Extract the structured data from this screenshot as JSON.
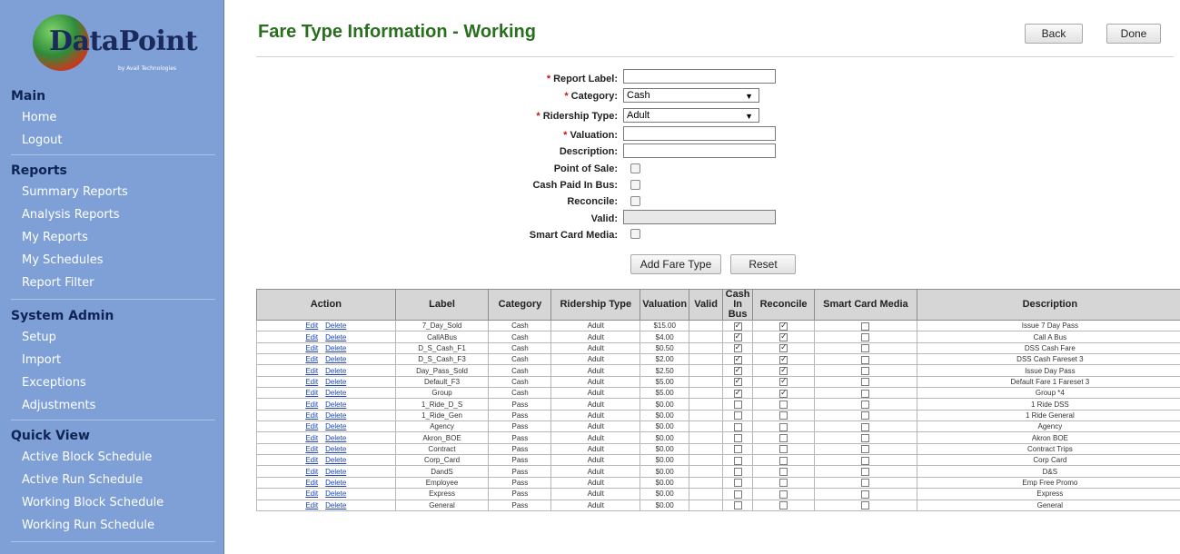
{
  "logo": {
    "text": "DataPoint",
    "subtext": "by Avail Technologies"
  },
  "nav": [
    {
      "title": "Main",
      "items": [
        "Home",
        "Logout"
      ]
    },
    {
      "title": "Reports",
      "items": [
        "Summary Reports",
        "Analysis Reports",
        "My Reports",
        "My Schedules",
        "Report Filter"
      ]
    },
    {
      "title": "System Admin",
      "items": [
        "Setup",
        "Import",
        "Exceptions",
        "Adjustments"
      ]
    },
    {
      "title": "Quick View",
      "items": [
        "Active Block Schedule",
        "Active Run Schedule",
        "Working Block Schedule",
        "Working Run Schedule"
      ]
    }
  ],
  "page": {
    "title": "Fare Type Information - Working"
  },
  "toolbar": {
    "back": "Back",
    "done": "Done"
  },
  "form": {
    "report_label": {
      "label": "Report Label:",
      "value": ""
    },
    "category": {
      "label": "Category:",
      "value": "Cash"
    },
    "ridership_type": {
      "label": "Ridership Type:",
      "value": "Adult"
    },
    "valuation": {
      "label": "Valuation:",
      "value": ""
    },
    "description": {
      "label": "Description:",
      "value": ""
    },
    "point_of_sale": {
      "label": "Point of Sale:"
    },
    "cash_paid_in_bus": {
      "label": "Cash Paid In Bus:"
    },
    "reconcile": {
      "label": "Reconcile:"
    },
    "valid": {
      "label": "Valid:",
      "value": ""
    },
    "smart_card_media": {
      "label": "Smart Card Media:"
    },
    "required_mark": "*",
    "add_button": "Add Fare Type",
    "reset_button": "Reset"
  },
  "table": {
    "headers": [
      "Action",
      "Label",
      "Category",
      "Ridership Type",
      "Valuation",
      "Valid",
      "Cash In Bus",
      "Reconcile",
      "Smart Card Media",
      "Description"
    ],
    "edit_label": "Edit",
    "delete_label": "Delete",
    "rows": [
      {
        "label": "7_Day_Sold",
        "category": "Cash",
        "ridership": "Adult",
        "valuation": "$15.00",
        "cash_in_bus": true,
        "reconcile": true,
        "smart_card": false,
        "description": "Issue 7 Day Pass"
      },
      {
        "label": "CallABus",
        "category": "Cash",
        "ridership": "Adult",
        "valuation": "$4.00",
        "cash_in_bus": true,
        "reconcile": true,
        "smart_card": false,
        "description": "Call A Bus"
      },
      {
        "label": "D_S_Cash_F1",
        "category": "Cash",
        "ridership": "Adult",
        "valuation": "$0.50",
        "cash_in_bus": true,
        "reconcile": true,
        "smart_card": false,
        "description": "DSS Cash Fare"
      },
      {
        "label": "D_S_Cash_F3",
        "category": "Cash",
        "ridership": "Adult",
        "valuation": "$2.00",
        "cash_in_bus": true,
        "reconcile": true,
        "smart_card": false,
        "description": "DSS Cash Fareset 3"
      },
      {
        "label": "Day_Pass_Sold",
        "category": "Cash",
        "ridership": "Adult",
        "valuation": "$2.50",
        "cash_in_bus": true,
        "reconcile": true,
        "smart_card": false,
        "description": "Issue Day Pass"
      },
      {
        "label": "Default_F3",
        "category": "Cash",
        "ridership": "Adult",
        "valuation": "$5.00",
        "cash_in_bus": true,
        "reconcile": true,
        "smart_card": false,
        "description": "Default Fare 1 Fareset 3"
      },
      {
        "label": "Group",
        "category": "Cash",
        "ridership": "Adult",
        "valuation": "$5.00",
        "cash_in_bus": true,
        "reconcile": true,
        "smart_card": false,
        "description": "Group *4"
      },
      {
        "label": "1_Ride_D_S",
        "category": "Pass",
        "ridership": "Adult",
        "valuation": "$0.00",
        "cash_in_bus": false,
        "reconcile": false,
        "smart_card": false,
        "description": "1 Ride DSS"
      },
      {
        "label": "1_Ride_Gen",
        "category": "Pass",
        "ridership": "Adult",
        "valuation": "$0.00",
        "cash_in_bus": false,
        "reconcile": false,
        "smart_card": false,
        "description": "1 Ride General"
      },
      {
        "label": "Agency",
        "category": "Pass",
        "ridership": "Adult",
        "valuation": "$0.00",
        "cash_in_bus": false,
        "reconcile": false,
        "smart_card": false,
        "description": "Agency"
      },
      {
        "label": "Akron_BOE",
        "category": "Pass",
        "ridership": "Adult",
        "valuation": "$0.00",
        "cash_in_bus": false,
        "reconcile": false,
        "smart_card": false,
        "description": "Akron BOE"
      },
      {
        "label": "Contract",
        "category": "Pass",
        "ridership": "Adult",
        "valuation": "$0.00",
        "cash_in_bus": false,
        "reconcile": false,
        "smart_card": false,
        "description": "Contract Trips"
      },
      {
        "label": "Corp_Card",
        "category": "Pass",
        "ridership": "Adult",
        "valuation": "$0.00",
        "cash_in_bus": false,
        "reconcile": false,
        "smart_card": false,
        "description": "Corp Card"
      },
      {
        "label": "DandS",
        "category": "Pass",
        "ridership": "Adult",
        "valuation": "$0.00",
        "cash_in_bus": false,
        "reconcile": false,
        "smart_card": false,
        "description": "D&S"
      },
      {
        "label": "Employee",
        "category": "Pass",
        "ridership": "Adult",
        "valuation": "$0.00",
        "cash_in_bus": false,
        "reconcile": false,
        "smart_card": false,
        "description": "Emp Free Promo"
      },
      {
        "label": "Express",
        "category": "Pass",
        "ridership": "Adult",
        "valuation": "$0.00",
        "cash_in_bus": false,
        "reconcile": false,
        "smart_card": false,
        "description": "Express"
      },
      {
        "label": "General",
        "category": "Pass",
        "ridership": "Adult",
        "valuation": "$0.00",
        "cash_in_bus": false,
        "reconcile": false,
        "smart_card": false,
        "description": "General"
      }
    ]
  }
}
